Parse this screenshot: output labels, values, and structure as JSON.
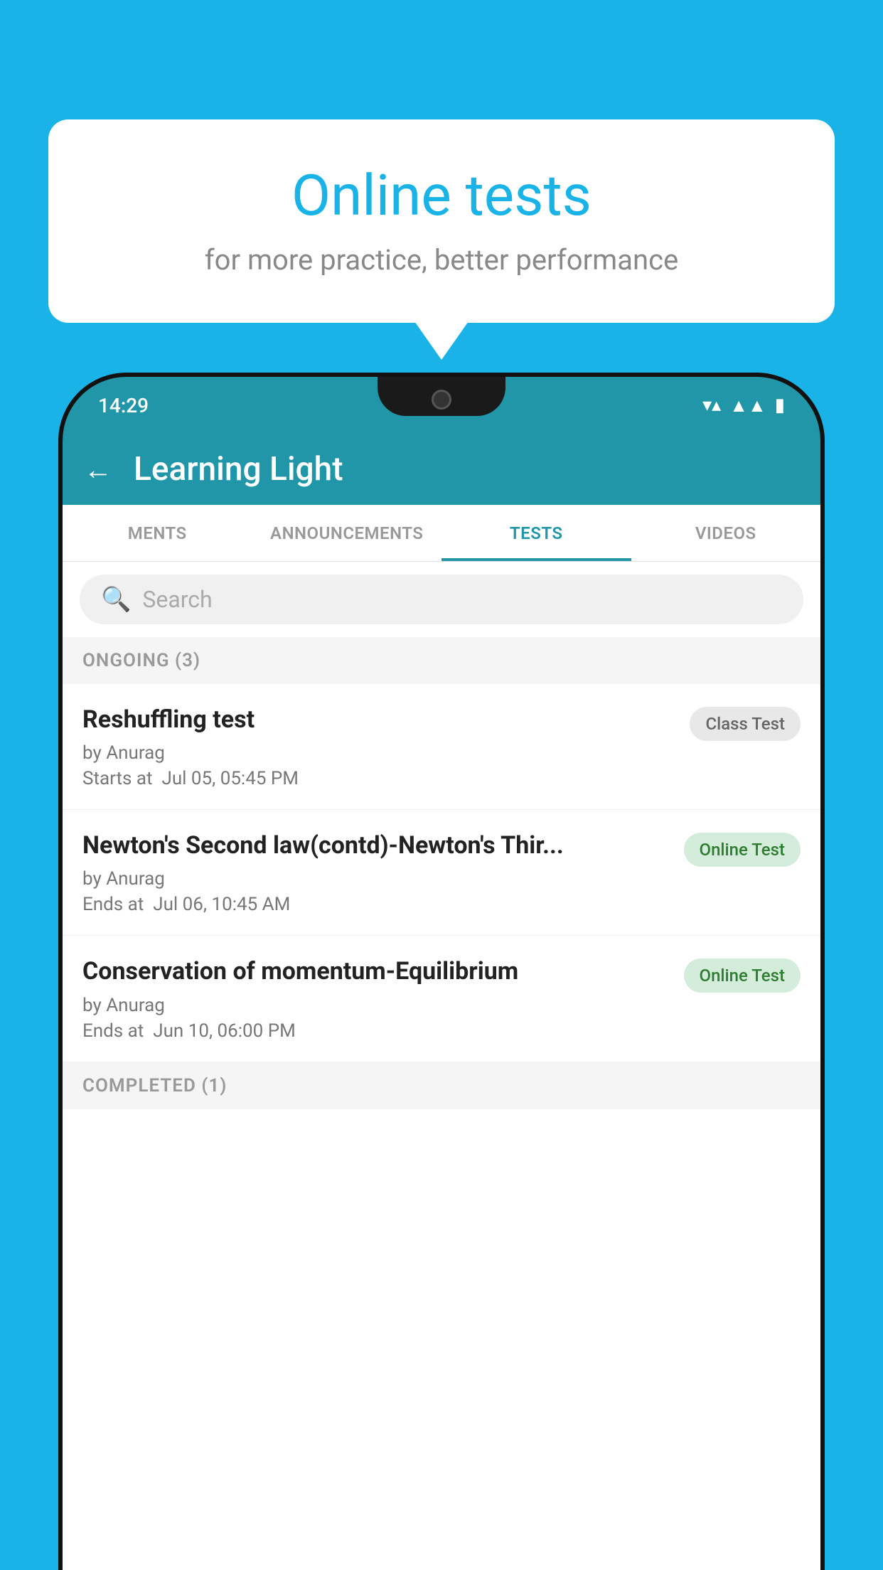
{
  "background_color": "#1ab3e8",
  "bubble": {
    "title": "Online tests",
    "subtitle": "for more practice, better performance"
  },
  "phone": {
    "status_bar": {
      "time": "14:29",
      "wifi_icon": "▼",
      "signal_icon": "◀",
      "battery_icon": "▮"
    },
    "header": {
      "back_label": "←",
      "title": "Learning Light"
    },
    "tabs": [
      {
        "label": "MENTS",
        "active": false
      },
      {
        "label": "ANNOUNCEMENTS",
        "active": false
      },
      {
        "label": "TESTS",
        "active": true
      },
      {
        "label": "VIDEOS",
        "active": false
      }
    ],
    "search": {
      "placeholder": "Search"
    },
    "ongoing_section": {
      "label": "ONGOING (3)"
    },
    "tests": [
      {
        "title": "Reshuffling test",
        "author": "by Anurag",
        "time_label": "Starts at",
        "time_value": "Jul 05, 05:45 PM",
        "badge": "Class Test",
        "badge_type": "class"
      },
      {
        "title": "Newton's Second law(contd)-Newton's Thir...",
        "author": "by Anurag",
        "time_label": "Ends at",
        "time_value": "Jul 06, 10:45 AM",
        "badge": "Online Test",
        "badge_type": "online"
      },
      {
        "title": "Conservation of momentum-Equilibrium",
        "author": "by Anurag",
        "time_label": "Ends at",
        "time_value": "Jun 10, 06:00 PM",
        "badge": "Online Test",
        "badge_type": "online"
      }
    ],
    "completed_section": {
      "label": "COMPLETED (1)"
    }
  }
}
